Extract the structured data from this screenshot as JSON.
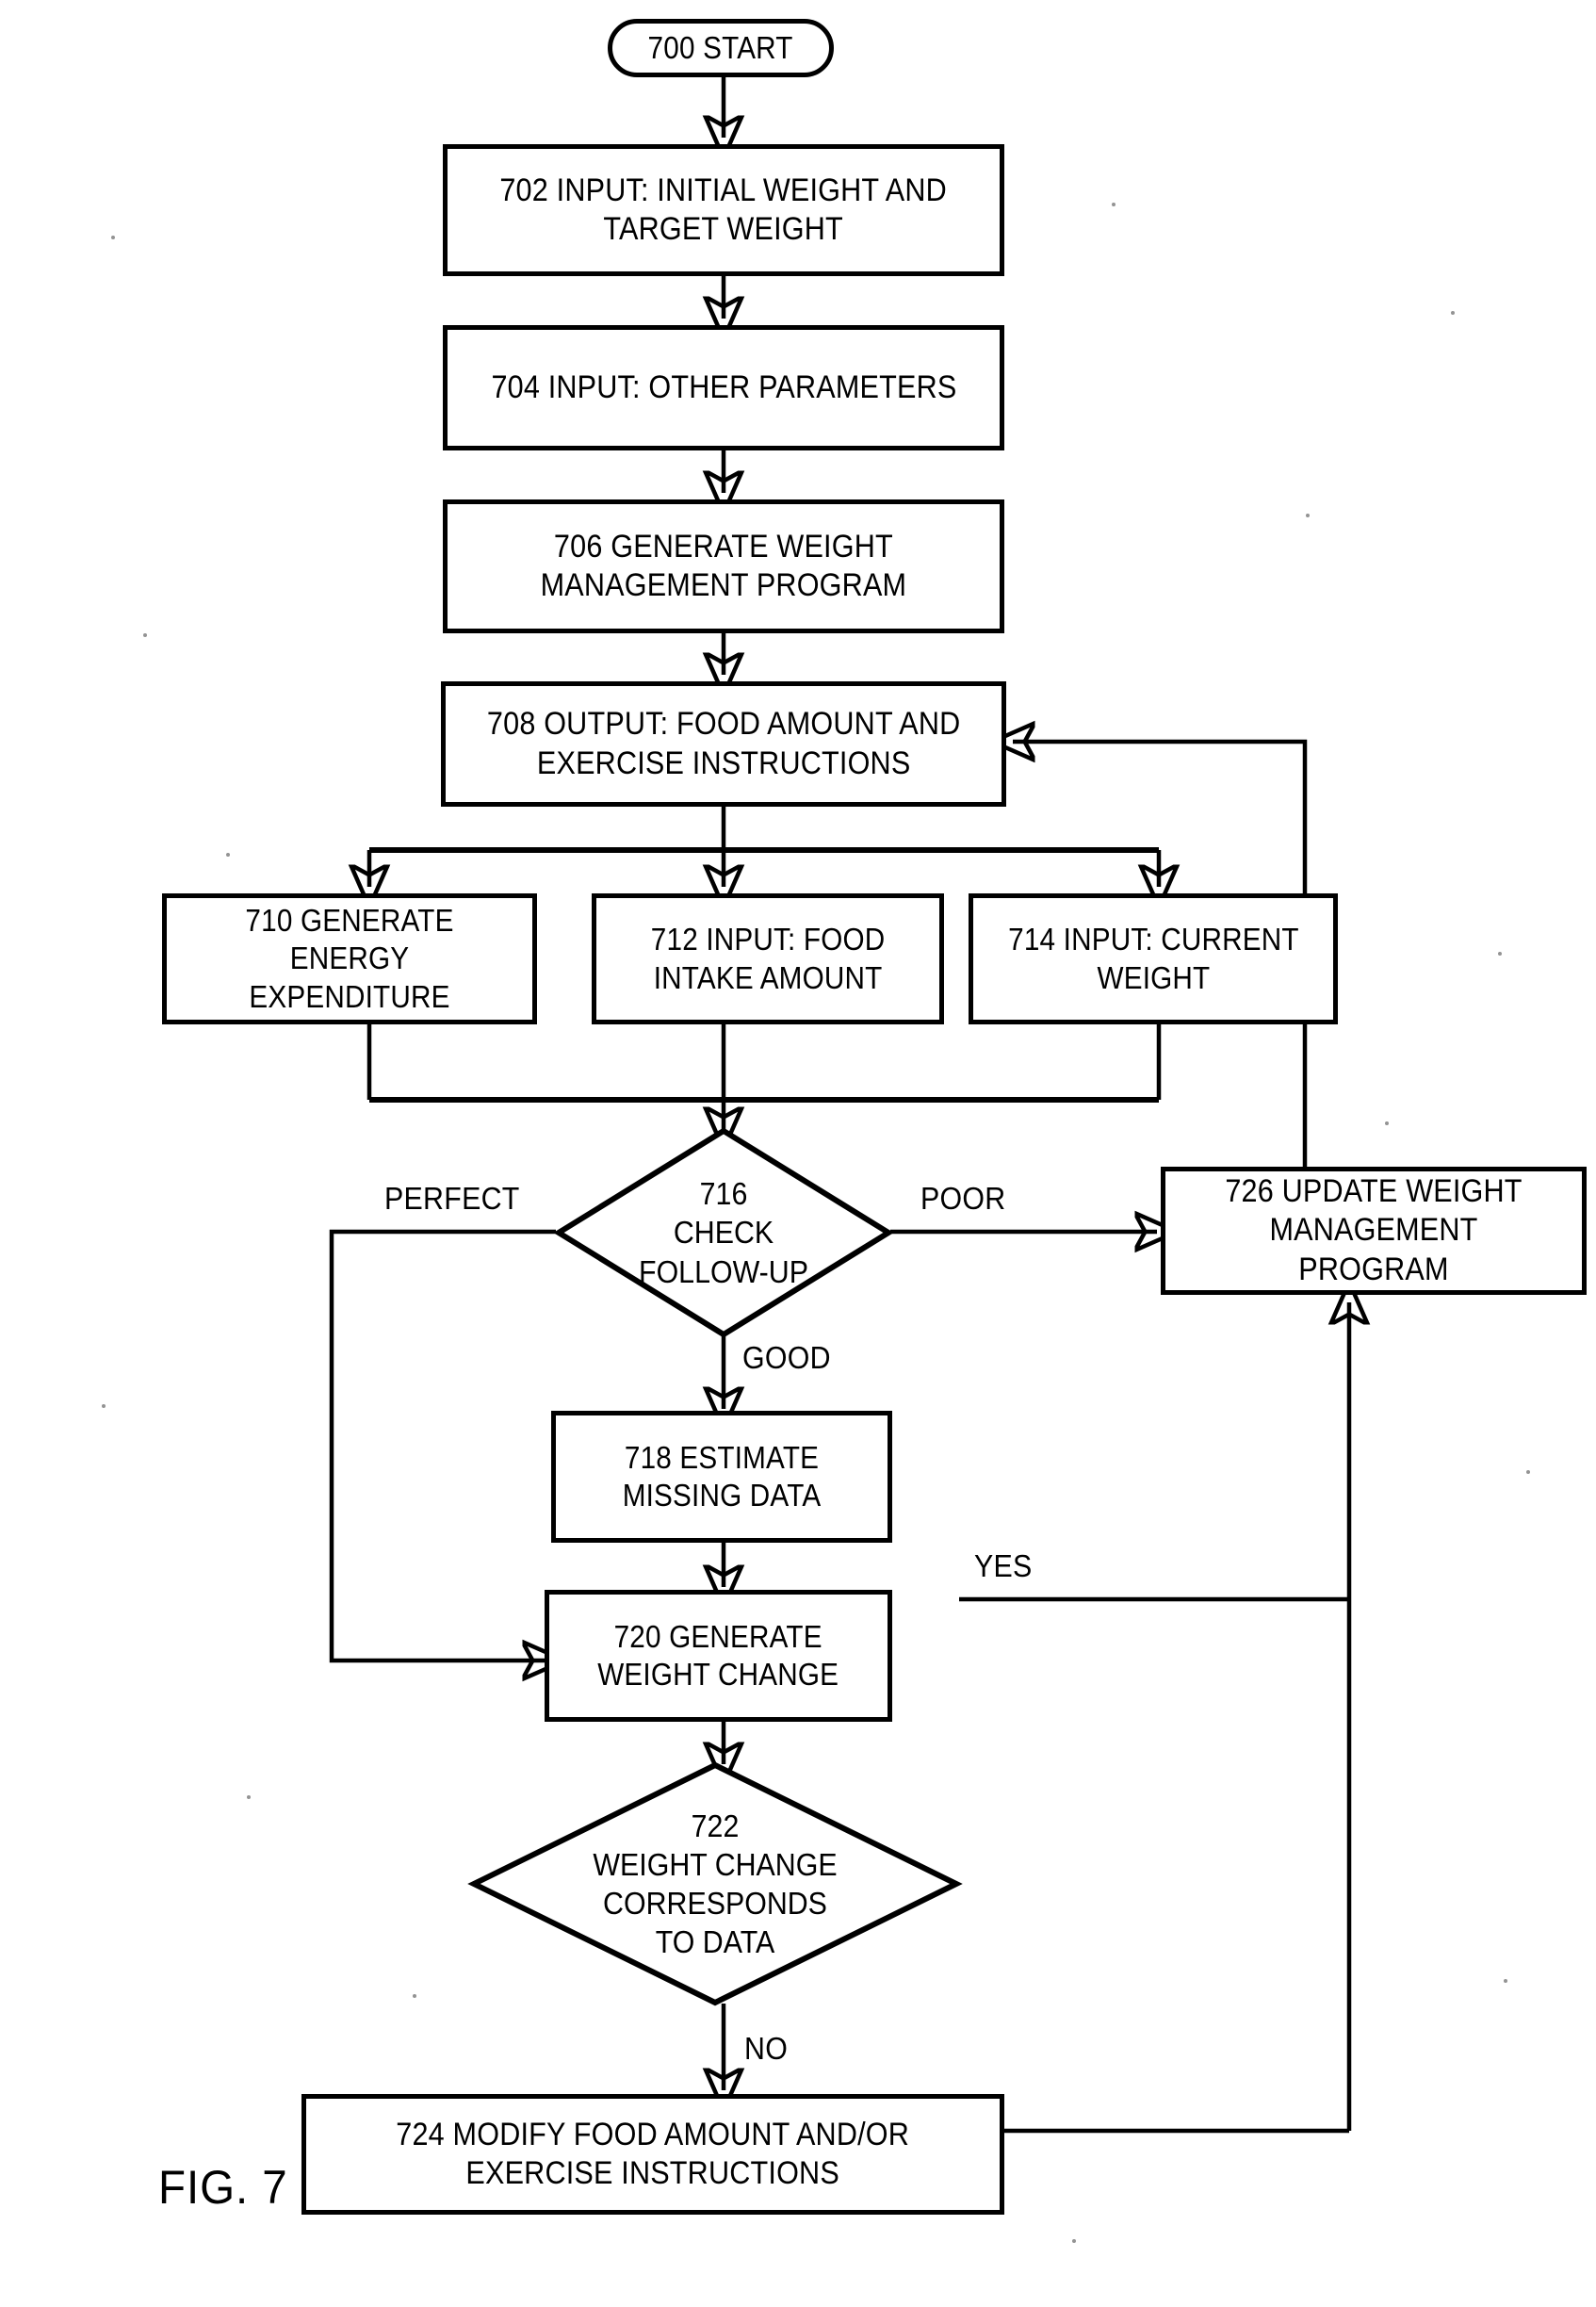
{
  "figure": {
    "caption": "FIG. 7",
    "title": "700 Weight management program flowchart"
  },
  "nodes": {
    "n700": {
      "id": "700",
      "text": "700 START",
      "shape": "terminator"
    },
    "n702": {
      "id": "702",
      "text": "702 INPUT: INITIAL WEIGHT AND\nTARGET WEIGHT",
      "shape": "process"
    },
    "n704": {
      "id": "704",
      "text": "704 INPUT: OTHER PARAMETERS",
      "shape": "process"
    },
    "n706": {
      "id": "706",
      "text": "706 GENERATE WEIGHT\nMANAGEMENT PROGRAM",
      "shape": "process"
    },
    "n708": {
      "id": "708",
      "text": "708 OUTPUT: FOOD AMOUNT AND\nEXERCISE INSTRUCTIONS",
      "shape": "process"
    },
    "n710": {
      "id": "710",
      "text": "710 GENERATE\nENERGY EXPENDITURE",
      "shape": "process"
    },
    "n712": {
      "id": "712",
      "text": "712 INPUT: FOOD\nINTAKE AMOUNT",
      "shape": "process"
    },
    "n714": {
      "id": "714",
      "text": "714 INPUT: CURRENT\nWEIGHT",
      "shape": "process"
    },
    "n716": {
      "id": "716",
      "text": "716\nCHECK\nFOLLOW-UP",
      "shape": "decision"
    },
    "n718": {
      "id": "718",
      "text": "718 ESTIMATE\nMISSING DATA",
      "shape": "process"
    },
    "n720": {
      "id": "720",
      "text": "720 GENERATE\nWEIGHT CHANGE",
      "shape": "process"
    },
    "n722": {
      "id": "722",
      "text": "722\nWEIGHT CHANGE\nCORRESPONDS\nTO DATA",
      "shape": "decision"
    },
    "n724": {
      "id": "724",
      "text": "724 MODIFY FOOD AMOUNT AND/OR\nEXERCISE INSTRUCTIONS",
      "shape": "process"
    },
    "n726": {
      "id": "726",
      "text": "726 UPDATE WEIGHT\nMANAGEMENT PROGRAM",
      "shape": "process"
    }
  },
  "edge_labels": {
    "perfect": "PERFECT",
    "poor": "POOR",
    "good": "GOOD",
    "yes": "YES",
    "no": "NO"
  },
  "edges": [
    {
      "from": "700",
      "to": "702",
      "label": ""
    },
    {
      "from": "702",
      "to": "704",
      "label": ""
    },
    {
      "from": "704",
      "to": "706",
      "label": ""
    },
    {
      "from": "706",
      "to": "708",
      "label": ""
    },
    {
      "from": "708",
      "to": "710",
      "label": ""
    },
    {
      "from": "708",
      "to": "712",
      "label": ""
    },
    {
      "from": "708",
      "to": "714",
      "label": ""
    },
    {
      "from": "710",
      "to": "716",
      "label": ""
    },
    {
      "from": "712",
      "to": "716",
      "label": ""
    },
    {
      "from": "714",
      "to": "716",
      "label": ""
    },
    {
      "from": "716",
      "to": "720",
      "label": "PERFECT"
    },
    {
      "from": "716",
      "to": "726",
      "label": "POOR"
    },
    {
      "from": "716",
      "to": "718",
      "label": "GOOD"
    },
    {
      "from": "718",
      "to": "720",
      "label": ""
    },
    {
      "from": "720",
      "to": "722",
      "label": ""
    },
    {
      "from": "722",
      "to": "726",
      "label": "YES"
    },
    {
      "from": "722",
      "to": "724",
      "label": "NO"
    },
    {
      "from": "724",
      "to": "726",
      "label": ""
    },
    {
      "from": "726",
      "to": "708",
      "label": ""
    }
  ],
  "style": {
    "ink": "#000000",
    "paper": "#ffffff"
  }
}
